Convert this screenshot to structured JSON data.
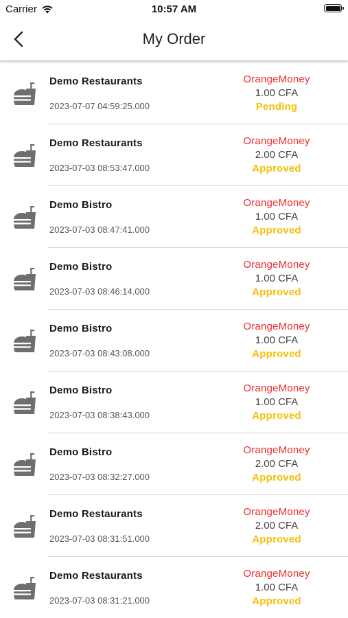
{
  "status_bar": {
    "carrier": "Carrier",
    "time": "10:57 AM"
  },
  "nav": {
    "title": "My Order",
    "back_icon": "chevron-left-icon"
  },
  "colors": {
    "payment_method": "#ee2c2c",
    "status": "#f5bf0a",
    "icon": "#6e6e6e"
  },
  "orders": [
    {
      "restaurant": "Demo Restaurants",
      "date": "2023-07-07 04:59:25.000",
      "payment_method": "OrangeMoney",
      "amount": "1.00 CFA",
      "status": "Pending",
      "icon": "food-drink-icon"
    },
    {
      "restaurant": "Demo Restaurants",
      "date": "2023-07-03 08:53:47.000",
      "payment_method": "OrangeMoney",
      "amount": "2.00 CFA",
      "status": "Approved",
      "icon": "food-drink-icon"
    },
    {
      "restaurant": "Demo Bistro",
      "date": "2023-07-03 08:47:41.000",
      "payment_method": "OrangeMoney",
      "amount": "1.00 CFA",
      "status": "Approved",
      "icon": "food-drink-icon"
    },
    {
      "restaurant": "Demo Bistro",
      "date": "2023-07-03 08:46:14.000",
      "payment_method": "OrangeMoney",
      "amount": "1.00 CFA",
      "status": "Approved",
      "icon": "food-drink-icon"
    },
    {
      "restaurant": "Demo Bistro",
      "date": "2023-07-03 08:43:08.000",
      "payment_method": "OrangeMoney",
      "amount": "1.00 CFA",
      "status": "Approved",
      "icon": "food-drink-icon"
    },
    {
      "restaurant": "Demo Bistro",
      "date": "2023-07-03 08:38:43.000",
      "payment_method": "OrangeMoney",
      "amount": "1.00 CFA",
      "status": "Approved",
      "icon": "food-drink-icon"
    },
    {
      "restaurant": "Demo Bistro",
      "date": "2023-07-03 08:32:27.000",
      "payment_method": "OrangeMoney",
      "amount": "2.00 CFA",
      "status": "Approved",
      "icon": "food-drink-icon"
    },
    {
      "restaurant": "Demo Restaurants",
      "date": "2023-07-03 08:31:51.000",
      "payment_method": "OrangeMoney",
      "amount": "2.00 CFA",
      "status": "Approved",
      "icon": "food-drink-icon"
    },
    {
      "restaurant": "Demo Restaurants",
      "date": "2023-07-03 08:31:21.000",
      "payment_method": "OrangeMoney",
      "amount": "1.00 CFA",
      "status": "Approved",
      "icon": "food-drink-icon"
    }
  ]
}
